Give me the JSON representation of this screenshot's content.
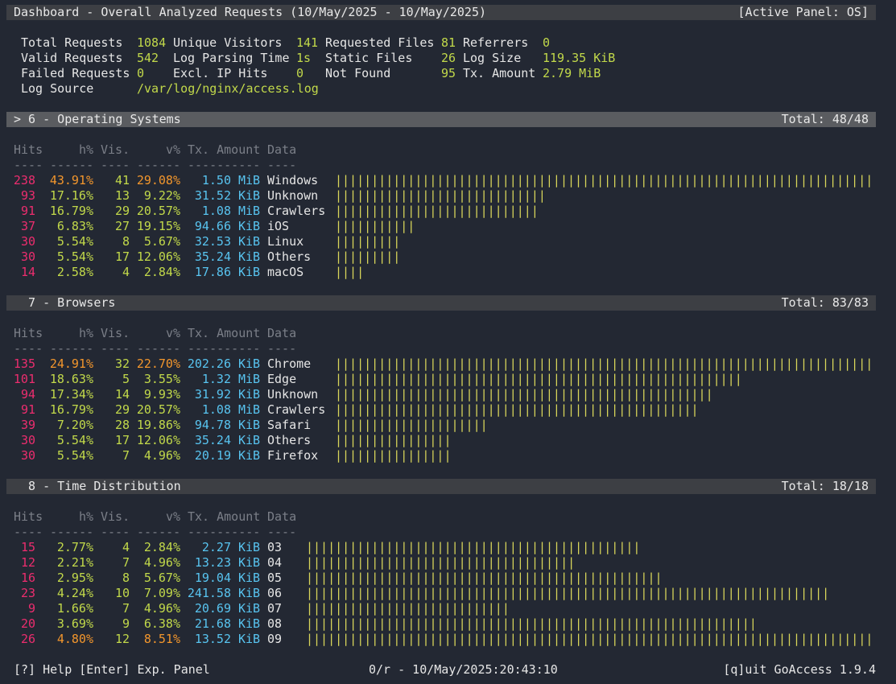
{
  "header": {
    "title": "Dashboard - Overall Analyzed Requests (10/May/2025 - 10/May/2025)",
    "active_panel": "[Active Panel: OS]"
  },
  "overall": {
    "total_requests_label": "Total Requests",
    "total_requests": "1084",
    "unique_visitors_label": "Unique Visitors",
    "unique_visitors": "141",
    "requested_files_label": "Requested Files",
    "requested_files": "81",
    "referrers_label": "Referrers",
    "referrers": "0",
    "valid_requests_label": "Valid Requests",
    "valid_requests": "542",
    "log_parsing_time_label": "Log Parsing Time",
    "log_parsing_time": "1s",
    "static_files_label": "Static Files",
    "static_files": "26",
    "log_size_label": "Log Size",
    "log_size": "119.35 KiB",
    "failed_requests_label": "Failed Requests",
    "failed_requests": "0",
    "excl_ip_hits_label": "Excl. IP Hits",
    "excl_ip_hits": "0",
    "not_found_label": "Not Found",
    "not_found": "95",
    "tx_amount_label": "Tx. Amount",
    "tx_amount": "2.79 MiB",
    "log_source_label": "Log Source",
    "log_source": "/var/log/nginx/access.log"
  },
  "columns": {
    "hits": "Hits",
    "hpct": "h%",
    "vis": "Vis.",
    "vpct": "v%",
    "tx": "Tx. Amount",
    "data": "Data",
    "sep_hits": "----",
    "sep_hpct": "------",
    "sep_vis": "----",
    "sep_vpct": "------",
    "sep_tx": "----------",
    "sep_data": "----"
  },
  "panels": {
    "os": {
      "title": "> 6 - Operating Systems",
      "total": "Total: 48/48",
      "rows": [
        {
          "hits": "238",
          "hpct": "43.91%",
          "vis": "41",
          "vpct": "29.08%",
          "tx": "1.50",
          "unit": "MiB",
          "data": "Windows",
          "bar": "|||||||||||||||||||||||||||||||||||||||||||||||||||||||||||||||||||||||||||||||"
        },
        {
          "hits": "93",
          "hpct": "17.16%",
          "vis": "13",
          "vpct": "9.22%",
          "tx": "31.52",
          "unit": "KiB",
          "data": "Unknown",
          "bar": "|||||||||||||||||||||||||||||"
        },
        {
          "hits": "91",
          "hpct": "16.79%",
          "vis": "29",
          "vpct": "20.57%",
          "tx": "1.08",
          "unit": "MiB",
          "data": "Crawlers",
          "bar": "||||||||||||||||||||||||||||"
        },
        {
          "hits": "37",
          "hpct": "6.83%",
          "vis": "27",
          "vpct": "19.15%",
          "tx": "94.66",
          "unit": "KiB",
          "data": "iOS",
          "bar": "|||||||||||"
        },
        {
          "hits": "30",
          "hpct": "5.54%",
          "vis": "8",
          "vpct": "5.67%",
          "tx": "32.53",
          "unit": "KiB",
          "data": "Linux",
          "bar": "|||||||||"
        },
        {
          "hits": "30",
          "hpct": "5.54%",
          "vis": "17",
          "vpct": "12.06%",
          "tx": "35.24",
          "unit": "KiB",
          "data": "Others",
          "bar": "|||||||||"
        },
        {
          "hits": "14",
          "hpct": "2.58%",
          "vis": "4",
          "vpct": "2.84%",
          "tx": "17.86",
          "unit": "KiB",
          "data": "macOS",
          "bar": "||||"
        }
      ]
    },
    "browsers": {
      "title": "  7 - Browsers",
      "total": "Total: 83/83",
      "rows": [
        {
          "hits": "135",
          "hpct": "24.91%",
          "vis": "32",
          "vpct": "22.70%",
          "tx": "202.26",
          "unit": "KiB",
          "data": "Chrome",
          "bar": "|||||||||||||||||||||||||||||||||||||||||||||||||||||||||||||||||||||||||||||||"
        },
        {
          "hits": "101",
          "hpct": "18.63%",
          "vis": "5",
          "vpct": "3.55%",
          "tx": "1.32",
          "unit": "MiB",
          "data": "Edge",
          "bar": "||||||||||||||||||||||||||||||||||||||||||||||||||||||||"
        },
        {
          "hits": "94",
          "hpct": "17.34%",
          "vis": "14",
          "vpct": "9.93%",
          "tx": "31.92",
          "unit": "KiB",
          "data": "Unknown",
          "bar": "||||||||||||||||||||||||||||||||||||||||||||||||||||"
        },
        {
          "hits": "91",
          "hpct": "16.79%",
          "vis": "29",
          "vpct": "20.57%",
          "tx": "1.08",
          "unit": "MiB",
          "data": "Crawlers",
          "bar": "||||||||||||||||||||||||||||||||||||||||||||||||||"
        },
        {
          "hits": "39",
          "hpct": "7.20%",
          "vis": "28",
          "vpct": "19.86%",
          "tx": "94.78",
          "unit": "KiB",
          "data": "Safari",
          "bar": "|||||||||||||||||||||"
        },
        {
          "hits": "30",
          "hpct": "5.54%",
          "vis": "17",
          "vpct": "12.06%",
          "tx": "35.24",
          "unit": "KiB",
          "data": "Others",
          "bar": "||||||||||||||||"
        },
        {
          "hits": "30",
          "hpct": "5.54%",
          "vis": "7",
          "vpct": "4.96%",
          "tx": "20.19",
          "unit": "KiB",
          "data": "Firefox",
          "bar": "||||||||||||||||"
        }
      ]
    },
    "time": {
      "title": "  8 - Time Distribution",
      "total": "Total: 18/18",
      "rows": [
        {
          "hits": "15",
          "hpct": "2.77%",
          "vis": "4",
          "vpct": "2.84%",
          "tx": "2.27",
          "unit": "KiB",
          "data": "03",
          "bar": "||||||||||||||||||||||||||||||||||||||||||||||"
        },
        {
          "hits": "12",
          "hpct": "2.21%",
          "vis": "7",
          "vpct": "4.96%",
          "tx": "13.23",
          "unit": "KiB",
          "data": "04",
          "bar": "|||||||||||||||||||||||||||||||||||||"
        },
        {
          "hits": "16",
          "hpct": "2.95%",
          "vis": "8",
          "vpct": "5.67%",
          "tx": "19.04",
          "unit": "KiB",
          "data": "05",
          "bar": "|||||||||||||||||||||||||||||||||||||||||||||||||"
        },
        {
          "hits": "23",
          "hpct": "4.24%",
          "vis": "10",
          "vpct": "7.09%",
          "tx": "241.58",
          "unit": "KiB",
          "data": "06",
          "bar": "||||||||||||||||||||||||||||||||||||||||||||||||||||||||||||||||||||||||"
        },
        {
          "hits": "9",
          "hpct": "1.66%",
          "vis": "7",
          "vpct": "4.96%",
          "tx": "20.69",
          "unit": "KiB",
          "data": "07",
          "bar": "||||||||||||||||||||||||||||"
        },
        {
          "hits": "20",
          "hpct": "3.69%",
          "vis": "9",
          "vpct": "6.38%",
          "tx": "21.68",
          "unit": "KiB",
          "data": "08",
          "bar": "||||||||||||||||||||||||||||||||||||||||||||||||||||||||||||||"
        },
        {
          "hits": "26",
          "hpct": "4.80%",
          "vis": "12",
          "vpct": "8.51%",
          "tx": "13.52",
          "unit": "KiB",
          "data": "09",
          "bar": "|||||||||||||||||||||||||||||||||||||||||||||||||||||||||||||||||||||||||||||||||"
        }
      ]
    }
  },
  "footer": {
    "help": "[?] Help [Enter] Exp. Panel",
    "status": "0/r - 10/May/2025:20:43:10",
    "quit": "[q]uit GoAccess 1.9.4"
  },
  "colors": {
    "background": "#232833",
    "panel_bar": "#3d3f44",
    "active_panel_bar": "#5a5c60",
    "hits": "#ec2d6e",
    "pct": "#c2d94a",
    "max_pct": "#f3962c",
    "tx": "#58c4f0",
    "bars": "#d9d65a"
  }
}
